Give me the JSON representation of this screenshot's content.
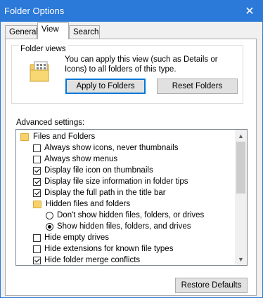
{
  "window": {
    "title": "Folder Options",
    "close_glyph": "✕"
  },
  "tabs": [
    {
      "label": "General",
      "active": false
    },
    {
      "label": "View",
      "active": true
    },
    {
      "label": "Search",
      "active": false
    }
  ],
  "folder_views": {
    "group_title": "Folder views",
    "description": "You can apply this view (such as Details or Icons) to all folders of this type.",
    "apply_button": "Apply to Folders",
    "reset_button": "Reset Folders"
  },
  "advanced": {
    "label": "Advanced settings:",
    "items": [
      {
        "type": "folder",
        "label": "Files and Folders",
        "indent": 0
      },
      {
        "type": "checkbox",
        "label": "Always show icons, never thumbnails",
        "checked": false,
        "indent": 1
      },
      {
        "type": "checkbox",
        "label": "Always show menus",
        "checked": false,
        "indent": 1
      },
      {
        "type": "checkbox",
        "label": "Display file icon on thumbnails",
        "checked": true,
        "indent": 1
      },
      {
        "type": "checkbox",
        "label": "Display file size information in folder tips",
        "checked": true,
        "indent": 1
      },
      {
        "type": "checkbox",
        "label": "Display the full path in the title bar",
        "checked": true,
        "indent": 1
      },
      {
        "type": "folder",
        "label": "Hidden files and folders",
        "indent": 1
      },
      {
        "type": "radio",
        "label": "Don't show hidden files, folders, or drives",
        "checked": false,
        "indent": 2
      },
      {
        "type": "radio",
        "label": "Show hidden files, folders, and drives",
        "checked": true,
        "indent": 2
      },
      {
        "type": "checkbox",
        "label": "Hide empty drives",
        "checked": false,
        "indent": 1
      },
      {
        "type": "checkbox",
        "label": "Hide extensions for known file types",
        "checked": false,
        "indent": 1
      },
      {
        "type": "checkbox",
        "label": "Hide folder merge conflicts",
        "checked": true,
        "indent": 1
      }
    ],
    "restore_button": "Restore Defaults"
  },
  "colors": {
    "titlebar": "#2b79d8",
    "folder_icon": "#f7d26b"
  },
  "icons": [
    "close-icon",
    "folder-view-icon",
    "folder-icon",
    "scroll-up-icon",
    "scroll-down-icon"
  ]
}
